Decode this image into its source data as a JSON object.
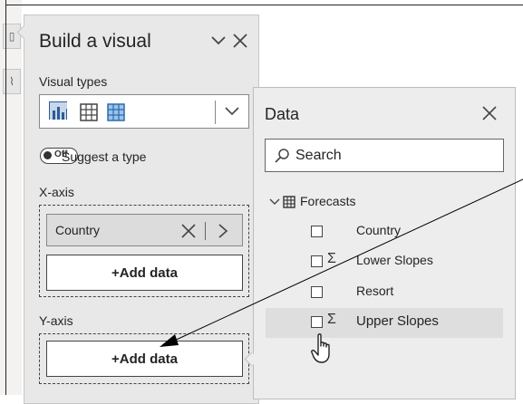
{
  "build_visual": {
    "title": "Build a visual",
    "collapse_icon": "chevron-down",
    "close_icon": "close",
    "visual_types_label": "Visual types",
    "suggest": {
      "toggle_state": "Off",
      "label": "Suggest a type"
    },
    "x_axis": {
      "label": "X-axis",
      "field": "Country",
      "add_label": "+Add data"
    },
    "y_axis": {
      "label": "Y-axis",
      "add_label": "+Add data"
    }
  },
  "data_pane": {
    "title": "Data",
    "close_icon": "close",
    "search_placeholder": "Search",
    "table": "Forecasts",
    "fields": [
      {
        "name": "Country",
        "type": "text"
      },
      {
        "name": "Lower Slopes",
        "type": "sum"
      },
      {
        "name": "Resort",
        "type": "text"
      },
      {
        "name": "Upper Slopes",
        "type": "sum",
        "hovered": true
      }
    ]
  },
  "colors": {
    "pane_bg": "#e8e8e8",
    "accent_blue": "#2b6cb0",
    "border": "#444444"
  }
}
